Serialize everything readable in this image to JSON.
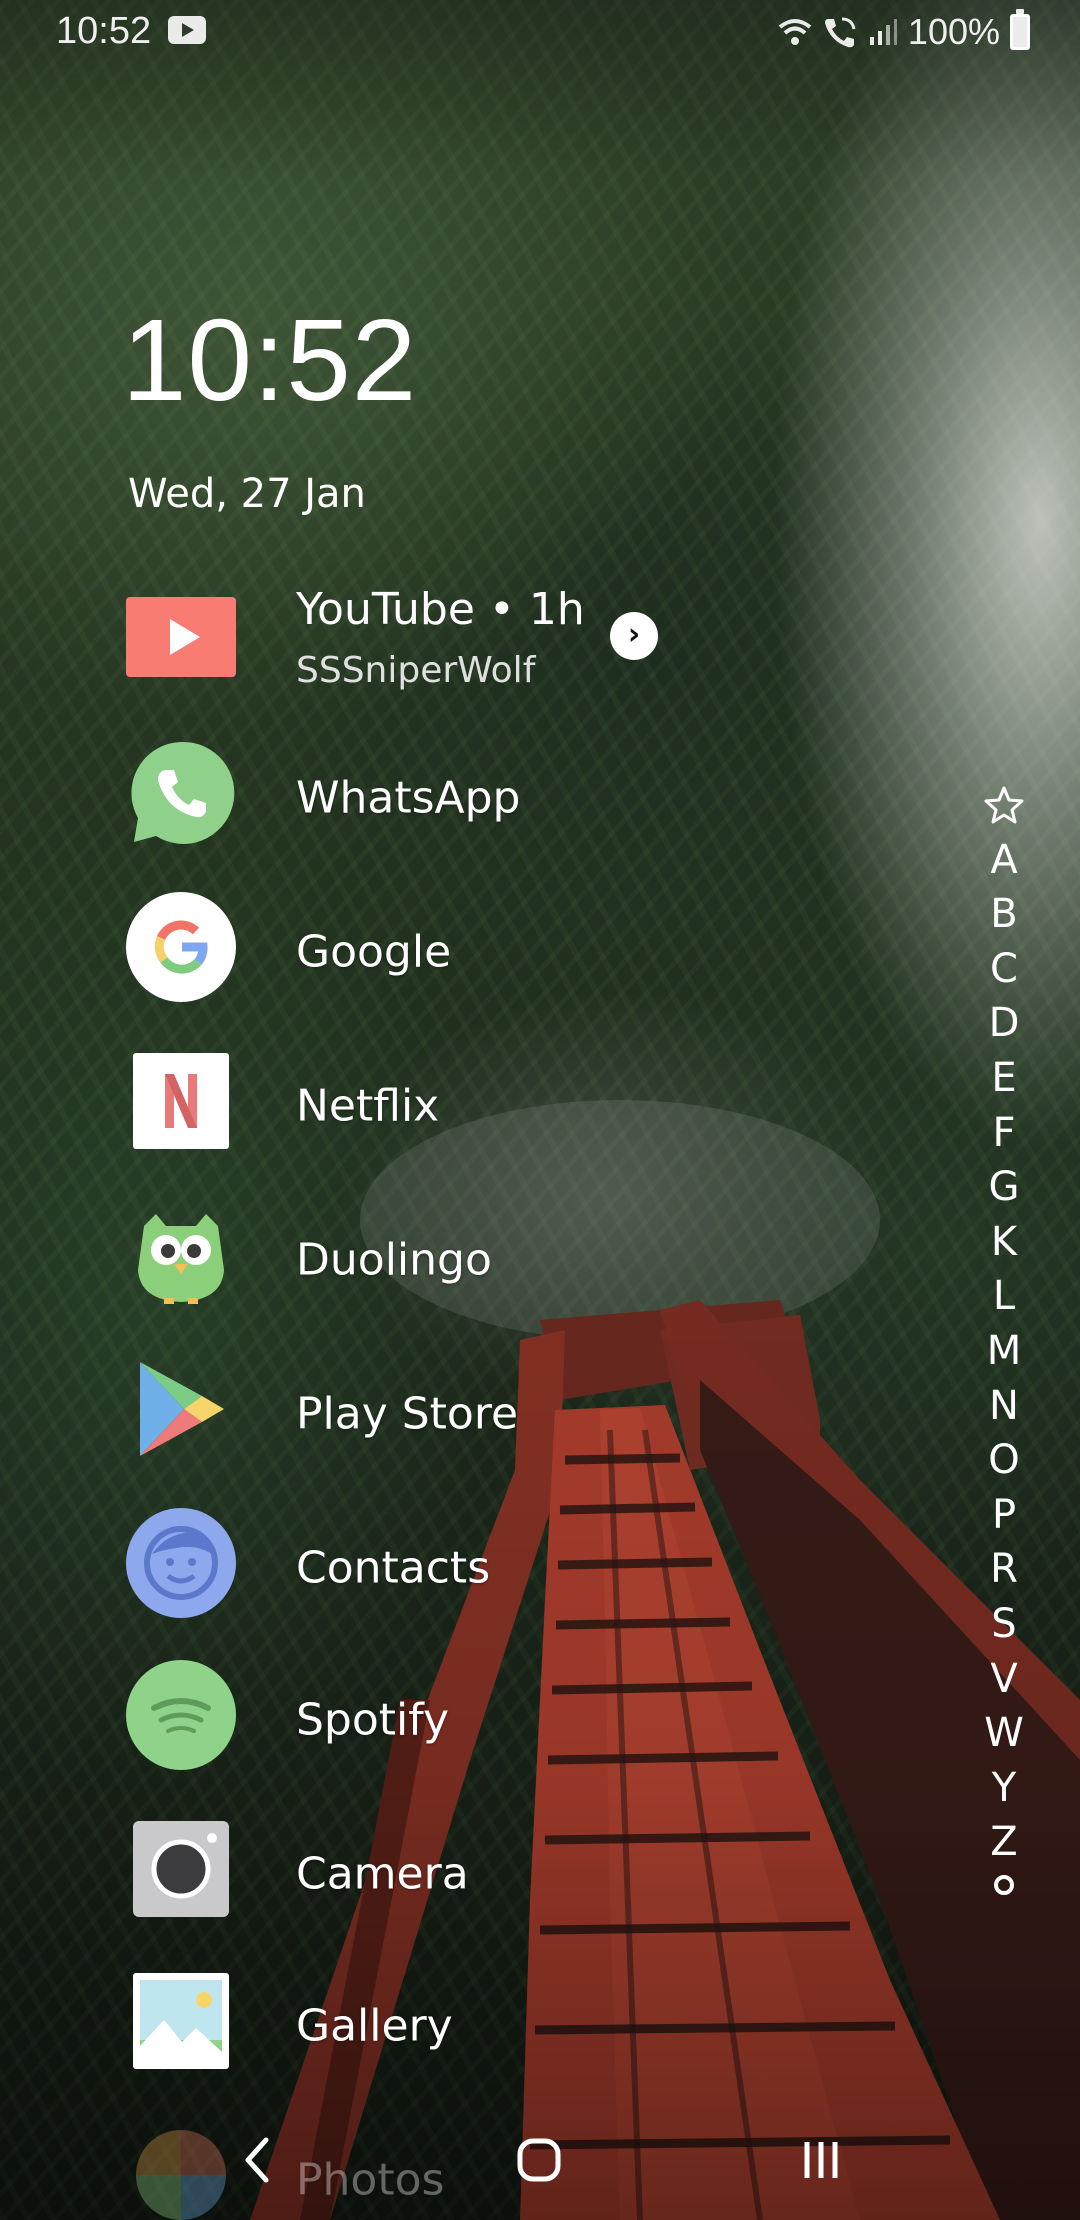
{
  "status_bar": {
    "time": "10:52",
    "battery_percent": "100%",
    "notification_icons": [
      "youtube-icon"
    ],
    "system_icons": [
      "wifi-icon",
      "wifi-calling-icon",
      "signal-icon",
      "battery-icon"
    ]
  },
  "clock_widget": {
    "time": "10:52",
    "date": "Wed, 27 Jan"
  },
  "notification_row": {
    "title": "YouTube • 1h",
    "subtitle": "SSSniperWolf",
    "icon": "youtube-icon",
    "accent": "#f87c72"
  },
  "apps": [
    {
      "label": "WhatsApp",
      "icon": "whatsapp-icon",
      "color": "#8fd18a"
    },
    {
      "label": "Google",
      "icon": "google-icon",
      "color": "#ffffff"
    },
    {
      "label": "Netflix",
      "icon": "netflix-icon",
      "color": "#e87a7a"
    },
    {
      "label": "Duolingo",
      "icon": "duolingo-icon",
      "color": "#8ccf7a"
    },
    {
      "label": "Play Store",
      "icon": "play-store-icon",
      "color": "#6fb0e8"
    },
    {
      "label": "Contacts",
      "icon": "contacts-icon",
      "color": "#8ea8ee"
    },
    {
      "label": "Spotify",
      "icon": "spotify-icon",
      "color": "#8fd28a"
    },
    {
      "label": "Camera",
      "icon": "camera-icon",
      "color": "#c9c9cc"
    },
    {
      "label": "Gallery",
      "icon": "gallery-icon",
      "color": "#bfe6ee"
    },
    {
      "label": "Photos",
      "icon": "photos-icon",
      "color": "#e0a04a"
    }
  ],
  "alphabet_index": [
    "A",
    "B",
    "C",
    "D",
    "E",
    "F",
    "G",
    "K",
    "L",
    "M",
    "N",
    "O",
    "P",
    "R",
    "S",
    "V",
    "W",
    "Y",
    "Z"
  ],
  "alphabet_index_extras": {
    "top": "star-icon",
    "bottom": "dot-icon"
  },
  "nav_bar": {
    "back": "back-icon",
    "home": "home-icon",
    "recents": "recents-icon"
  }
}
